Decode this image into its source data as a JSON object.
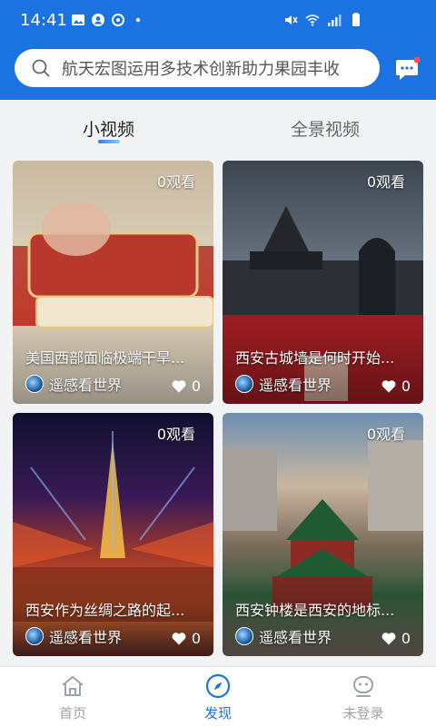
{
  "status_bar": {
    "time": "14:41",
    "left_icons": [
      "image-icon",
      "account-icon",
      "sync-icon",
      "dot-icon"
    ],
    "right_icons": [
      "mute-icon",
      "wifi-icon",
      "signal-icon",
      "battery-icon"
    ]
  },
  "search": {
    "placeholder": "航天宏图运用多技术创新助力果园丰收"
  },
  "tabs": [
    {
      "label": "小视频",
      "active": true
    },
    {
      "label": "全景视频",
      "active": false
    }
  ],
  "videos": [
    {
      "views": "0观看",
      "title": "美国西部面临极端干旱...",
      "author": "遥感看世界",
      "likes": "0"
    },
    {
      "views": "0观看",
      "title": "西安古城墙是何时开始...",
      "author": "遥感看世界",
      "likes": "0"
    },
    {
      "views": "0观看",
      "title": "西安作为丝绸之路的起...",
      "author": "遥感看世界",
      "likes": "0"
    },
    {
      "views": "0观看",
      "title": "西安钟楼是西安的地标...",
      "author": "遥感看世界",
      "likes": "0"
    }
  ],
  "bottom_nav": [
    {
      "label": "首页",
      "icon": "home-icon",
      "active": false
    },
    {
      "label": "发现",
      "icon": "compass-icon",
      "active": true
    },
    {
      "label": "未登录",
      "icon": "user-icon",
      "active": false
    }
  ],
  "colors": {
    "brand": "#1a73e0",
    "nav_inactive": "#9aa3ad",
    "background": "#f2f3f5"
  }
}
